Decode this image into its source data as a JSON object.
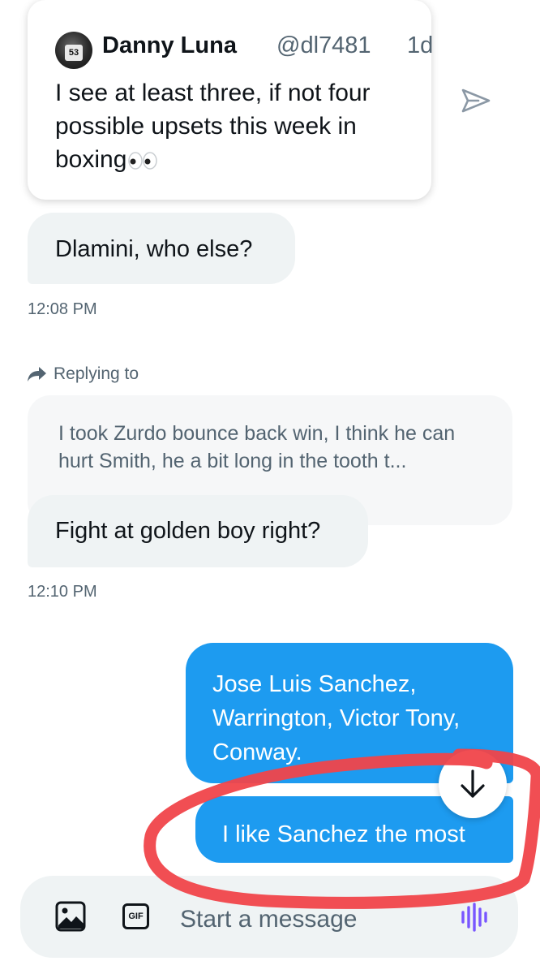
{
  "quoted_tweet": {
    "author_name": "Danny Luna",
    "author_handle": "@dl7481",
    "age": "1d",
    "text": "I see at least three, if not four possible upsets this week in boxing",
    "avatar_label": "53"
  },
  "messages": [
    {
      "direction": "incoming",
      "text": "Dlamini, who else?",
      "time": "12:08 PM"
    },
    {
      "direction": "incoming",
      "reply_label": "Replying to",
      "quoted_text": "I took Zurdo bounce back win, I think he can hurt Smith, he a bit long in the tooth t...",
      "text": "Fight at golden boy right?",
      "time": "12:10 PM"
    },
    {
      "direction": "outgoing",
      "text": "Jose Luis Sanchez, Warrington, Victor Tony, Conway."
    },
    {
      "direction": "outgoing",
      "text": "I like Sanchez the most"
    }
  ],
  "composer": {
    "placeholder": "Start a message",
    "gif_label": "GIF"
  },
  "icons": {
    "share": "share-icon",
    "reply": "reply-arrow-icon",
    "scroll_down": "arrow-down-icon",
    "image": "image-icon",
    "gif": "gif-icon",
    "voice": "voice-wave-icon",
    "eyes": "eyes-emoji-icon"
  },
  "colors": {
    "accent": "#1d9bf0",
    "incoming_bubble": "#eff3f4",
    "annotation": "#f0444a",
    "voice": "#7856ff"
  }
}
